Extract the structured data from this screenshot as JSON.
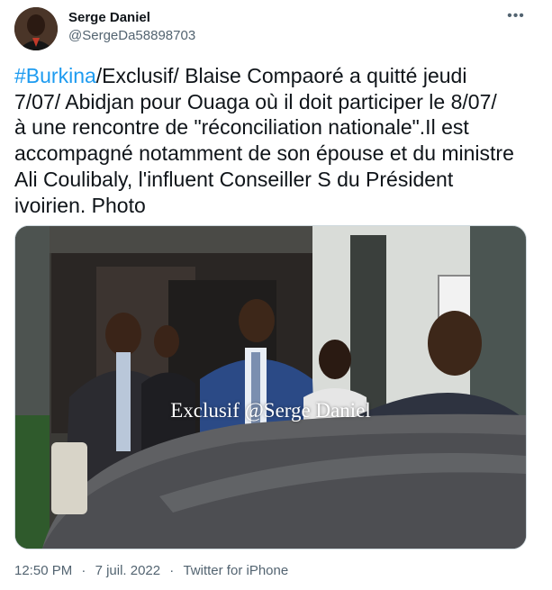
{
  "author": {
    "display_name": "Serge Daniel",
    "handle": "@SergeDa58898703"
  },
  "tweet": {
    "hashtag": "#Burkina",
    "text": "/Exclusif/ Blaise Compaoré a quitté jeudi\n7/07/ Abidjan pour Ouaga où il doit participer le 8/07/\nà une rencontre de \"réconciliation nationale\".Il est\naccompagné notamment de son épouse et du ministre\nAli Coulibaly, l'influent Conseiller S  du Président\nivoirien. Photo"
  },
  "photo": {
    "watermark": "Exclusif @Serge Daniel"
  },
  "meta": {
    "time": "12:50 PM",
    "separator": "·",
    "date": "7 juil. 2022",
    "source": "Twitter for iPhone"
  },
  "icons": {
    "more": "more-horizontal-icon"
  },
  "colors": {
    "link": "#1d9bf0",
    "text": "#0f1419",
    "secondary": "#536471"
  }
}
